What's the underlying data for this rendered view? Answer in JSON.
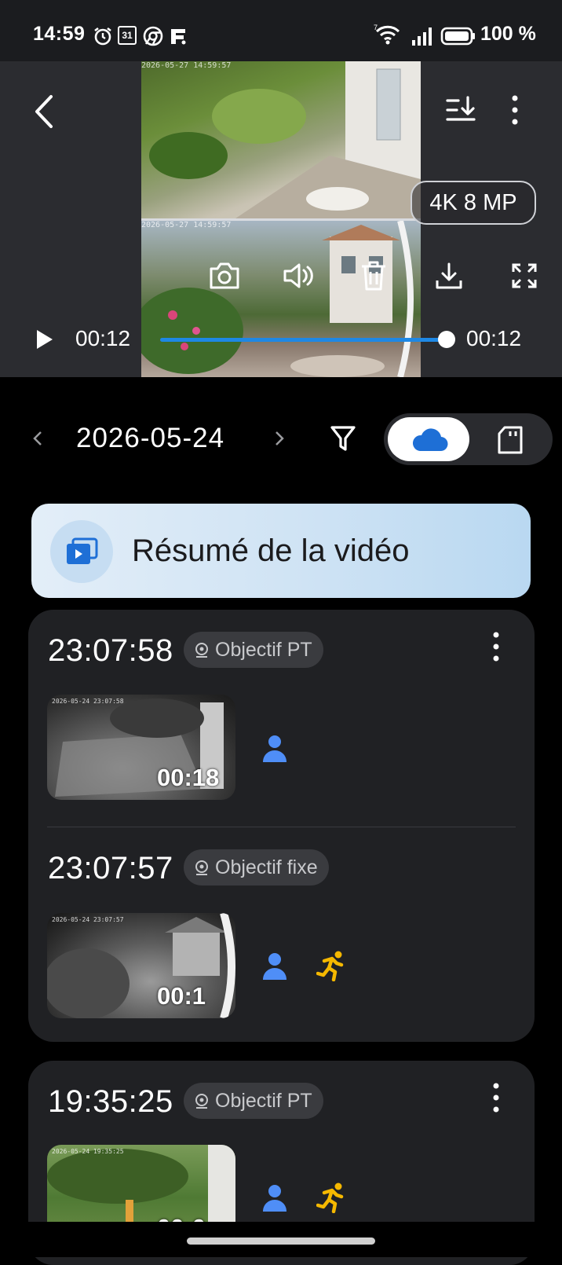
{
  "status_bar": {
    "time": "14:59",
    "calendar_day": "31",
    "battery": "100 %",
    "icons": [
      "alarm-icon",
      "calendar-icon",
      "chrome-icon",
      "app-f-icon",
      "wifi-icon",
      "signal-icon",
      "battery-icon"
    ]
  },
  "player": {
    "feed_timestamp_top": "2026-05-27 14:59:57",
    "feed_timestamp_bottom": "2026-05-27 14:59:57",
    "quality": "4K 8 MP",
    "current_time": "00:12",
    "total_time": "00:12",
    "progress": 1.0,
    "icons": [
      "back-arrow-icon",
      "sort-download-icon",
      "more-vertical-icon",
      "camera-icon",
      "speaker-icon",
      "trash-icon",
      "download-icon",
      "fullscreen-icon",
      "play-icon"
    ]
  },
  "date_bar": {
    "date": "2026-05-24",
    "storage_selected": "cloud",
    "icons": [
      "chevron-left-icon",
      "chevron-right-icon",
      "filter-icon",
      "cloud-icon",
      "sd-card-icon"
    ]
  },
  "summary": {
    "label": "Résumé de la vidéo",
    "icon": "video-stack-icon"
  },
  "events": [
    {
      "time": "23:07:58",
      "lens": "Objectif PT",
      "duration": "00:18",
      "thumb_timestamp": "2026-05-24 23:07:58",
      "detections": [
        "person-icon"
      ]
    },
    {
      "time": "23:07:57",
      "lens": "Objectif fixe",
      "duration": "00:1",
      "thumb_timestamp": "2026-05-24 23:07:57",
      "detections": [
        "person-icon",
        "running-icon"
      ]
    },
    {
      "time": "19:35:25",
      "lens": "Objectif PT",
      "duration": "00:0",
      "thumb_timestamp": "2026-05-24 19:35:25",
      "detections": [
        "person-icon",
        "running-icon"
      ]
    }
  ],
  "colors": {
    "accent_blue": "#1e88e5",
    "person_blue": "#4f8ef7",
    "motion_yellow": "#f5b800",
    "card_bg": "#202124"
  }
}
